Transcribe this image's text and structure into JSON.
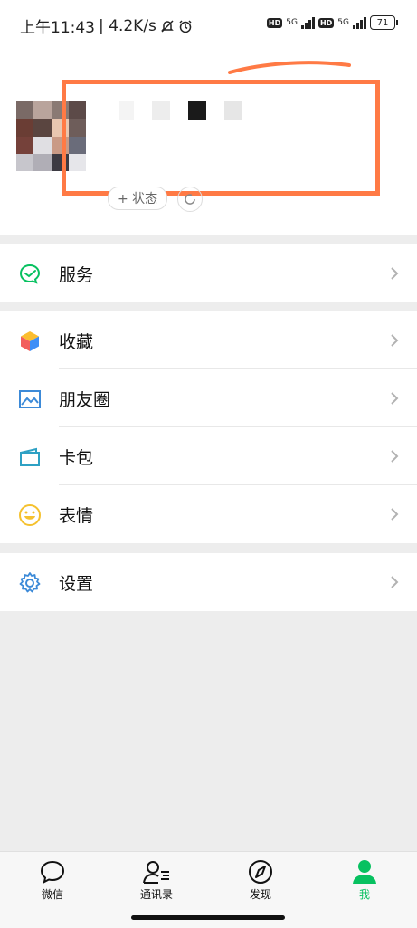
{
  "status_bar": {
    "time": "上午11:43",
    "speed": "| 4.2K/s",
    "hd1": "HD",
    "net1": "5G",
    "hd2": "HD",
    "net2": "5G",
    "battery": "71"
  },
  "profile": {
    "status_chip_label": "+ 状态",
    "annotation_color": "#ff7a45"
  },
  "groups": {
    "services": {
      "label": "服务"
    },
    "favorites": {
      "label": "收藏"
    },
    "moments": {
      "label": "朋友圈"
    },
    "cards": {
      "label": "卡包"
    },
    "stickers": {
      "label": "表情"
    },
    "settings": {
      "label": "设置"
    }
  },
  "tabbar": {
    "chats": "微信",
    "contacts": "通讯录",
    "discover": "发现",
    "me": "我"
  },
  "colors": {
    "accent": "#07c160",
    "background": "#ededed"
  }
}
